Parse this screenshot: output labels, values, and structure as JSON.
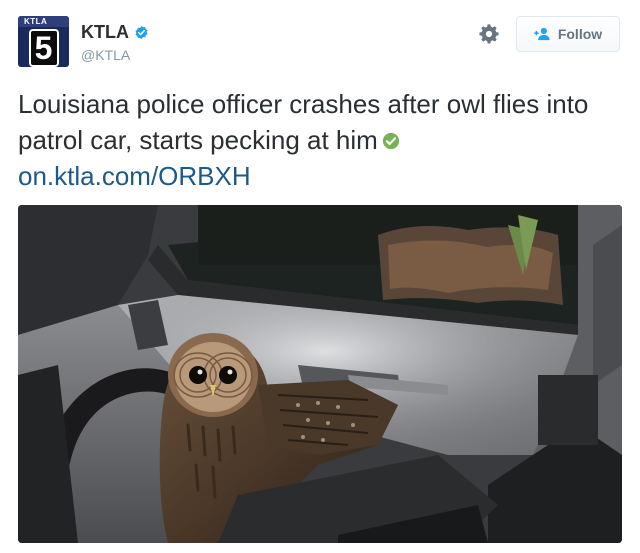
{
  "account": {
    "display_name": "KTLA",
    "handle": "@KTLA",
    "avatar_top_text": "KTLA",
    "avatar_number": "5",
    "verified_icon": "verified-badge-icon"
  },
  "actions": {
    "follow_label": "Follow",
    "settings_icon": "gear-icon"
  },
  "tweet": {
    "text": "Louisiana police officer crashes after owl flies into patrol car, starts pecking at him",
    "link": "on.ktla.com/ORBXH",
    "emoji_icon": "check-mark-icon"
  },
  "media": {
    "subject": "owl-in-patrol-car-photo"
  },
  "colors": {
    "link": "#1b5a8a",
    "verified": "#1da1f2",
    "emoji_green": "#77b255",
    "avatar_bg": "#1a2a5c"
  }
}
